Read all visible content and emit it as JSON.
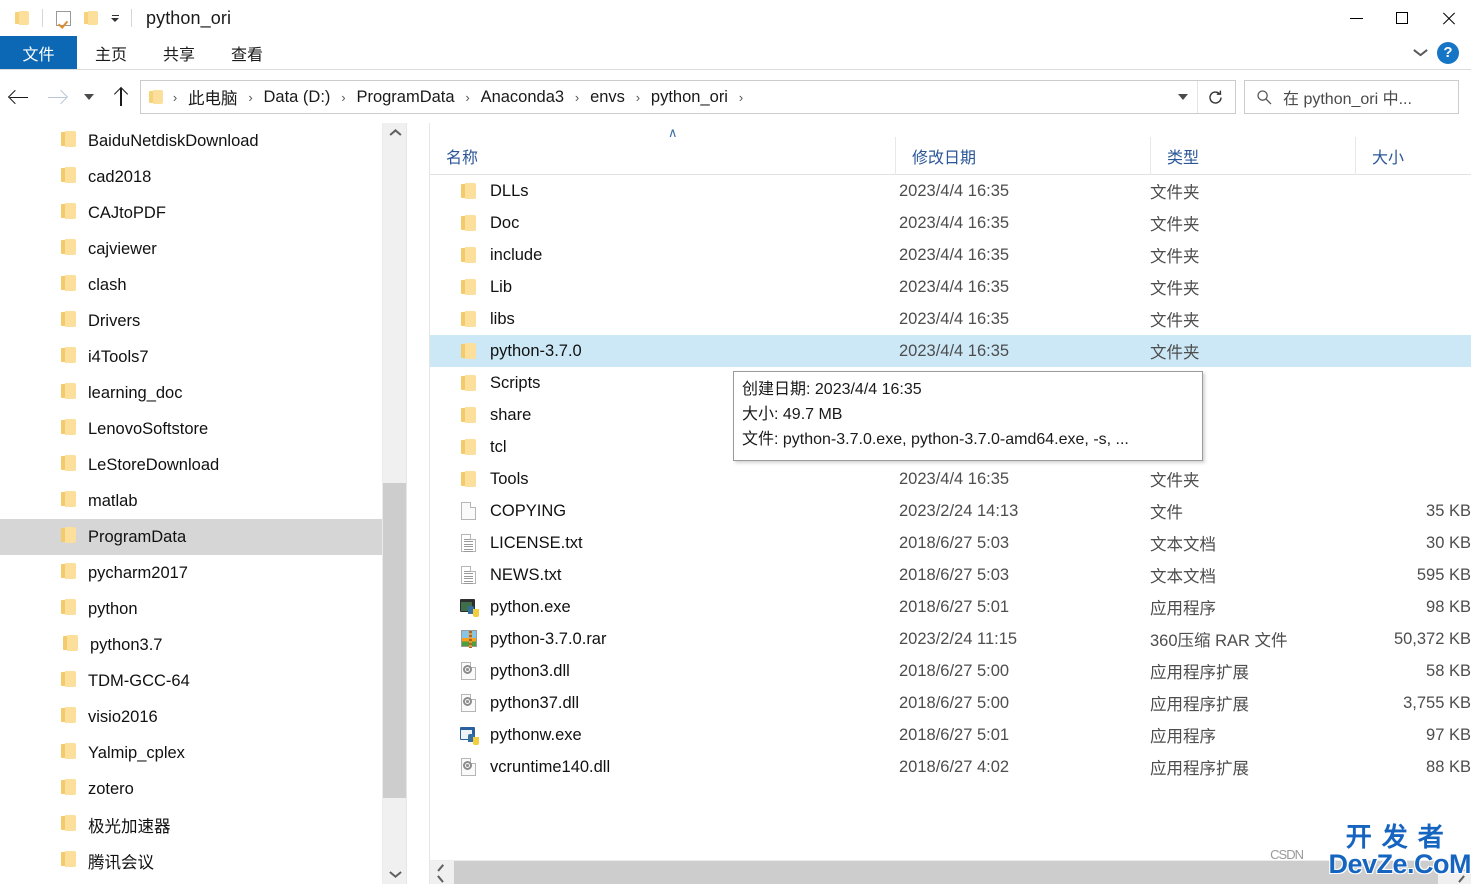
{
  "window": {
    "title": "python_ori",
    "quick_access": [
      "folder-icon",
      "properties-checkbox-icon",
      "new-folder-icon"
    ],
    "controls": {
      "minimize": "—",
      "maximize": "□",
      "close": "✕"
    }
  },
  "ribbon": {
    "tabs": [
      {
        "label": "文件",
        "active": true
      },
      {
        "label": "主页",
        "active": false
      },
      {
        "label": "共享",
        "active": false
      },
      {
        "label": "查看",
        "active": false
      }
    ],
    "help_label": "?"
  },
  "address": {
    "back": "←",
    "forward": "→",
    "recent_caret": "▾",
    "up": "↑",
    "crumbs": [
      "此电脑",
      "Data (D:)",
      "ProgramData",
      "Anaconda3",
      "envs",
      "python_ori"
    ],
    "separator": "›",
    "refresh": "↻"
  },
  "search": {
    "placeholder": "在 python_ori 中...",
    "icon": "search-icon"
  },
  "nav_tree": [
    {
      "label": "BaiduNetdiskDownload",
      "depth": 1,
      "selected": false
    },
    {
      "label": "cad2018",
      "depth": 1,
      "selected": false
    },
    {
      "label": "CAJtoPDF",
      "depth": 1,
      "selected": false
    },
    {
      "label": "cajviewer",
      "depth": 1,
      "selected": false
    },
    {
      "label": "clash",
      "depth": 1,
      "selected": false
    },
    {
      "label": "Drivers",
      "depth": 1,
      "selected": false
    },
    {
      "label": "i4Tools7",
      "depth": 1,
      "selected": false
    },
    {
      "label": "learning_doc",
      "depth": 1,
      "selected": false
    },
    {
      "label": "LenovoSoftstore",
      "depth": 1,
      "selected": false
    },
    {
      "label": "LeStoreDownload",
      "depth": 1,
      "selected": false
    },
    {
      "label": "matlab",
      "depth": 1,
      "selected": false
    },
    {
      "label": "ProgramData",
      "depth": 1,
      "selected": true
    },
    {
      "label": "pycharm2017",
      "depth": 1,
      "selected": false
    },
    {
      "label": "python",
      "depth": 1,
      "selected": false
    },
    {
      "label": "python3.7",
      "depth": 2,
      "selected": false
    },
    {
      "label": "TDM-GCC-64",
      "depth": 1,
      "selected": false
    },
    {
      "label": "visio2016",
      "depth": 1,
      "selected": false
    },
    {
      "label": "Yalmip_cplex",
      "depth": 1,
      "selected": false
    },
    {
      "label": "zotero",
      "depth": 1,
      "selected": false
    },
    {
      "label": "极光加速器",
      "depth": 1,
      "selected": false
    },
    {
      "label": "腾讯会议",
      "depth": 1,
      "selected": false
    }
  ],
  "columns": {
    "name": "名称",
    "date": "修改日期",
    "type": "类型",
    "size": "大小",
    "sort_marker": "∧"
  },
  "files": [
    {
      "name": "DLLs",
      "date": "2023/4/4 16:35",
      "type": "文件夹",
      "size": "",
      "icon": "folder-icon",
      "selected": false
    },
    {
      "name": "Doc",
      "date": "2023/4/4 16:35",
      "type": "文件夹",
      "size": "",
      "icon": "folder-icon",
      "selected": false
    },
    {
      "name": "include",
      "date": "2023/4/4 16:35",
      "type": "文件夹",
      "size": "",
      "icon": "folder-icon",
      "selected": false
    },
    {
      "name": "Lib",
      "date": "2023/4/4 16:35",
      "type": "文件夹",
      "size": "",
      "icon": "folder-icon",
      "selected": false
    },
    {
      "name": "libs",
      "date": "2023/4/4 16:35",
      "type": "文件夹",
      "size": "",
      "icon": "folder-icon",
      "selected": false
    },
    {
      "name": "python-3.7.0",
      "date": "2023/4/4 16:35",
      "type": "文件夹",
      "size": "",
      "icon": "folder-icon",
      "selected": true
    },
    {
      "name": "Scripts",
      "date": "",
      "type": "",
      "size": "",
      "icon": "folder-icon",
      "selected": false
    },
    {
      "name": "share",
      "date": "",
      "type": "",
      "size": "",
      "icon": "folder-icon",
      "selected": false
    },
    {
      "name": "tcl",
      "date": "2023/4/4 16:35",
      "type": "文件夹",
      "size": "",
      "icon": "folder-icon",
      "selected": false
    },
    {
      "name": "Tools",
      "date": "2023/4/4 16:35",
      "type": "文件夹",
      "size": "",
      "icon": "folder-icon",
      "selected": false
    },
    {
      "name": "COPYING",
      "date": "2023/2/24 14:13",
      "type": "文件",
      "size": "35 KB",
      "icon": "page-icon",
      "selected": false
    },
    {
      "name": "LICENSE.txt",
      "date": "2018/6/27 5:03",
      "type": "文本文档",
      "size": "30 KB",
      "icon": "text-file-icon",
      "selected": false
    },
    {
      "name": "NEWS.txt",
      "date": "2018/6/27 5:03",
      "type": "文本文档",
      "size": "595 KB",
      "icon": "text-file-icon",
      "selected": false
    },
    {
      "name": "python.exe",
      "date": "2018/6/27 5:01",
      "type": "应用程序",
      "size": "98 KB",
      "icon": "python-console-exe-icon",
      "selected": false
    },
    {
      "name": "python-3.7.0.rar",
      "date": "2023/2/24 11:15",
      "type": "360压缩 RAR 文件",
      "size": "50,372 KB",
      "icon": "rar-archive-icon",
      "selected": false
    },
    {
      "name": "python3.dll",
      "date": "2018/6/27 5:00",
      "type": "应用程序扩展",
      "size": "58 KB",
      "icon": "dll-icon",
      "selected": false
    },
    {
      "name": "python37.dll",
      "date": "2018/6/27 5:00",
      "type": "应用程序扩展",
      "size": "3,755 KB",
      "icon": "dll-icon",
      "selected": false
    },
    {
      "name": "pythonw.exe",
      "date": "2018/6/27 5:01",
      "type": "应用程序",
      "size": "97 KB",
      "icon": "python-window-exe-icon",
      "selected": false
    },
    {
      "name": "vcruntime140.dll",
      "date": "2018/6/27 4:02",
      "type": "应用程序扩展",
      "size": "88 KB",
      "icon": "dll-icon",
      "selected": false
    }
  ],
  "tooltip": {
    "created_label": "创建日期: 2023/4/4 16:35",
    "size_label": "大小: 49.7 MB",
    "files_label": "文件: python-3.7.0.exe, python-3.7.0-amd64.exe, -s, ..."
  },
  "watermark": {
    "cn": "开发者",
    "en": "DevZe.CoM",
    "faint": "CSDN"
  },
  "colors": {
    "accent": "#0c68b5",
    "selection": "#cce8f7",
    "nav_selection": "#d6d6d6",
    "column_header_text": "#2b5797",
    "watermark": "#1565c0"
  }
}
